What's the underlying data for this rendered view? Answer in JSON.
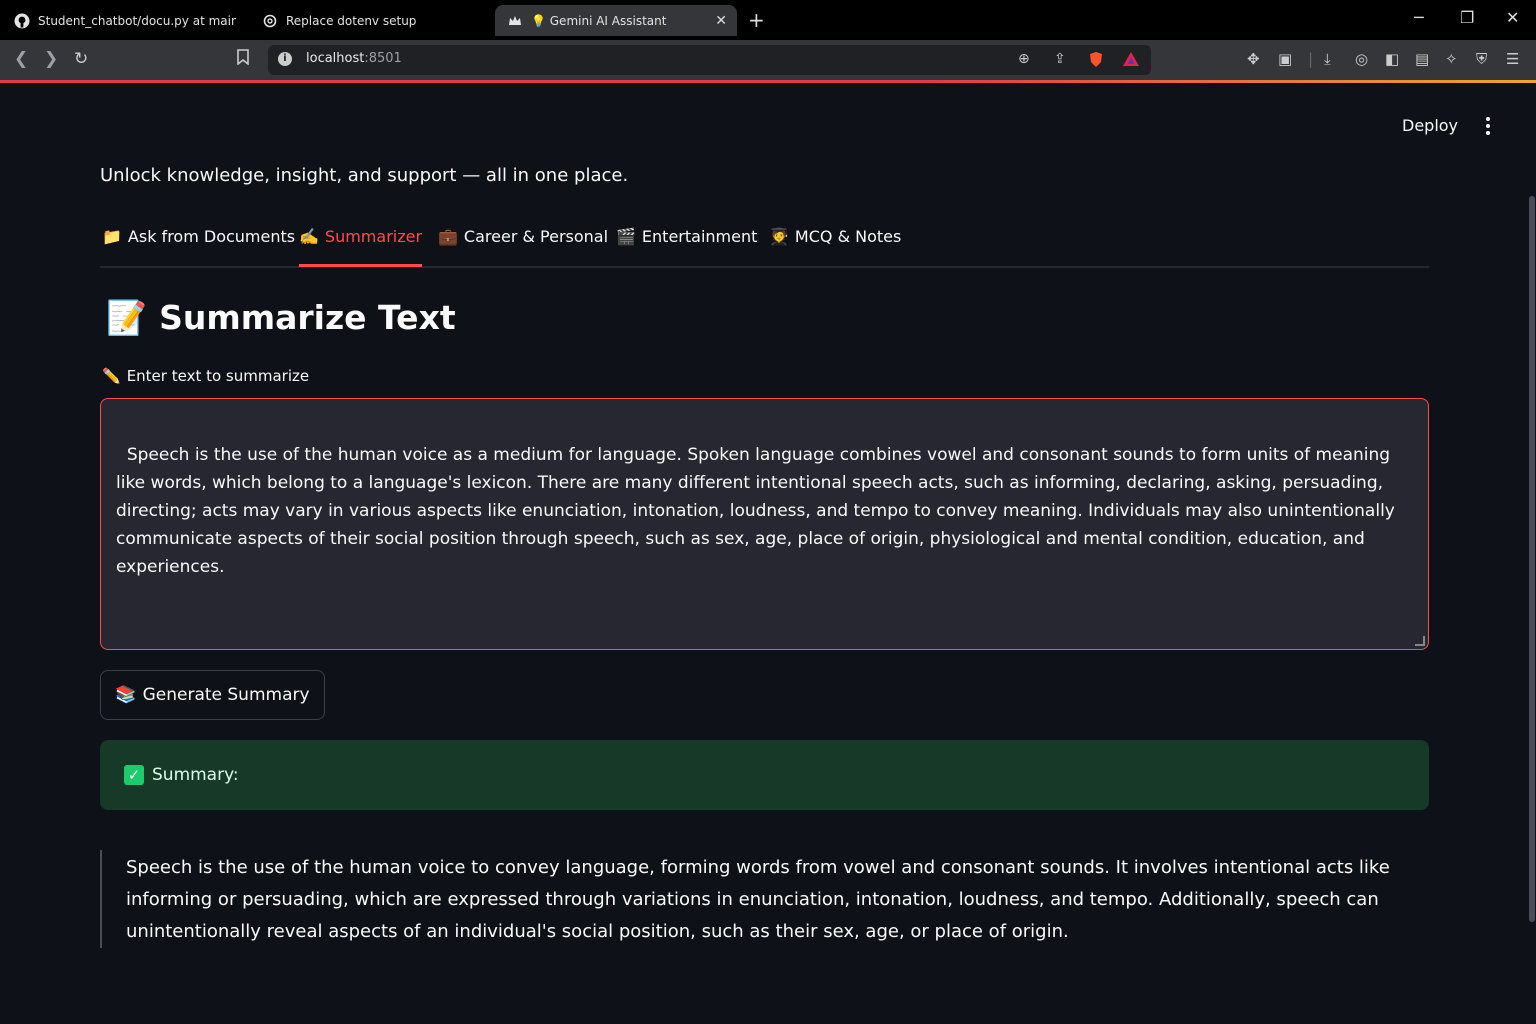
{
  "browser": {
    "tabs": [
      {
        "title": "Student_chatbot/docu.py at main · Sa",
        "icon": "github-icon"
      },
      {
        "title": "Replace dotenv setup",
        "icon": "openai-icon"
      },
      {
        "title": "💡 Gemini AI Assistant",
        "icon": "streamlit-crown-icon"
      }
    ],
    "url_host": "localhost",
    "url_port": ":8501"
  },
  "app": {
    "deploy_label": "Deploy",
    "tagline": "Unlock knowledge, insight, and support — all in one place.",
    "tabs": [
      {
        "emoji": "📁",
        "label": "Ask from Documents"
      },
      {
        "emoji": "✍️",
        "label": "Summarizer"
      },
      {
        "emoji": "💼",
        "label": "Career & Personal"
      },
      {
        "emoji": "🎬",
        "label": "Entertainment"
      },
      {
        "emoji": "🧑‍🎓",
        "label": "MCQ & Notes"
      }
    ],
    "active_tab": "Summarizer",
    "heading_emoji": "📝",
    "heading": "Summarize Text",
    "input_label_emoji": "✏️",
    "input_label": "Enter text to summarize",
    "input_value": "Speech is the use of the human voice as a medium for language. Spoken language combines vowel and consonant sounds to form units of meaning like words, which belong to a language's lexicon. There are many different intentional speech acts, such as informing, declaring, asking, persuading, directing; acts may vary in various aspects like enunciation, intonation, loudness, and tempo to convey meaning. Individuals may also unintentionally communicate aspects of their social position through speech, such as sex, age, place of origin, physiological and mental condition, education, and experiences.",
    "generate_emoji": "📚",
    "generate_label": "Generate Summary",
    "success_label": "Summary:",
    "summary": "Speech is the use of the human voice to convey language, forming words from vowel and consonant sounds. It involves intentional acts like informing or persuading, which are expressed through variations in enunciation, intonation, loudness, and tempo. Additionally, speech can unintentionally reveal aspects of an individual's social position, such as their sex, age, or place of origin."
  },
  "colors": {
    "background": "#0e1117",
    "accent": "#ff4b4b",
    "success_bg": "#173928",
    "input_bg": "#262730"
  }
}
